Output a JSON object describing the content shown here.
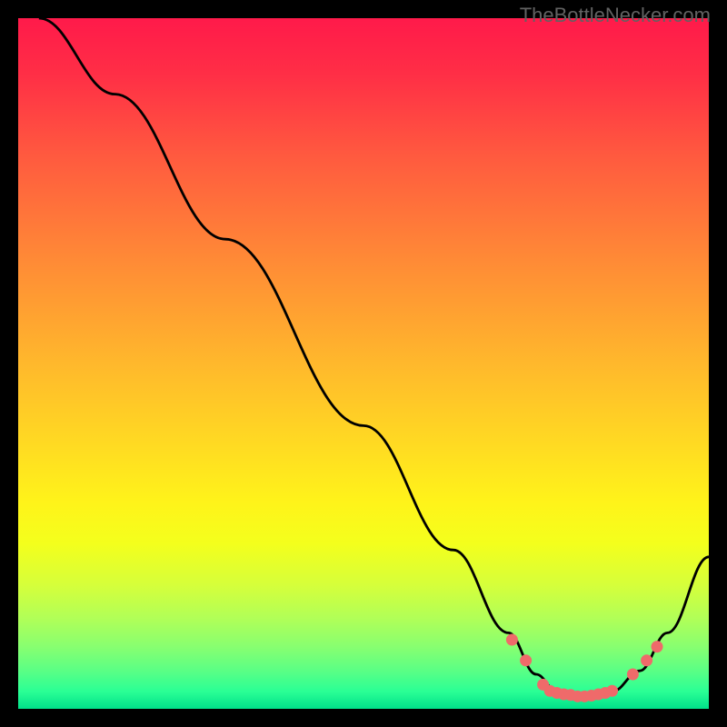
{
  "watermark": "TheBottleNecker.com",
  "chart_data": {
    "type": "line",
    "title": "",
    "xlabel": "",
    "ylabel": "",
    "xlim": [
      0,
      100
    ],
    "ylim": [
      0,
      100
    ],
    "gradient_stops": [
      {
        "offset": 0.0,
        "color": "#ff1a4a"
      },
      {
        "offset": 0.08,
        "color": "#ff2e46"
      },
      {
        "offset": 0.2,
        "color": "#ff5a3f"
      },
      {
        "offset": 0.35,
        "color": "#ff8a36"
      },
      {
        "offset": 0.5,
        "color": "#ffb82c"
      },
      {
        "offset": 0.62,
        "color": "#ffdb22"
      },
      {
        "offset": 0.7,
        "color": "#fff31a"
      },
      {
        "offset": 0.76,
        "color": "#f4ff1c"
      },
      {
        "offset": 0.82,
        "color": "#d6ff3a"
      },
      {
        "offset": 0.87,
        "color": "#b0ff58"
      },
      {
        "offset": 0.91,
        "color": "#88ff70"
      },
      {
        "offset": 0.945,
        "color": "#5aff85"
      },
      {
        "offset": 0.975,
        "color": "#2aff95"
      },
      {
        "offset": 1.0,
        "color": "#00e08a"
      }
    ],
    "series": [
      {
        "name": "curve",
        "points": [
          {
            "x": 3,
            "y": 100
          },
          {
            "x": 14,
            "y": 89
          },
          {
            "x": 30,
            "y": 68
          },
          {
            "x": 50,
            "y": 41
          },
          {
            "x": 63,
            "y": 23
          },
          {
            "x": 71,
            "y": 11
          },
          {
            "x": 75,
            "y": 5
          },
          {
            "x": 78,
            "y": 2.5
          },
          {
            "x": 82,
            "y": 1.8
          },
          {
            "x": 86,
            "y": 2.5
          },
          {
            "x": 90,
            "y": 5.5
          },
          {
            "x": 94,
            "y": 11
          },
          {
            "x": 100,
            "y": 22
          }
        ]
      }
    ],
    "markers": [
      {
        "x": 71.5,
        "y": 10
      },
      {
        "x": 73.5,
        "y": 7
      },
      {
        "x": 76,
        "y": 3.5
      },
      {
        "x": 77,
        "y": 2.6
      },
      {
        "x": 78,
        "y": 2.3
      },
      {
        "x": 79,
        "y": 2.1
      },
      {
        "x": 80,
        "y": 2.0
      },
      {
        "x": 81,
        "y": 1.8
      },
      {
        "x": 82,
        "y": 1.8
      },
      {
        "x": 83,
        "y": 1.9
      },
      {
        "x": 84,
        "y": 2.1
      },
      {
        "x": 85,
        "y": 2.3
      },
      {
        "x": 86,
        "y": 2.6
      },
      {
        "x": 89,
        "y": 5
      },
      {
        "x": 91,
        "y": 7
      },
      {
        "x": 92.5,
        "y": 9
      }
    ]
  }
}
